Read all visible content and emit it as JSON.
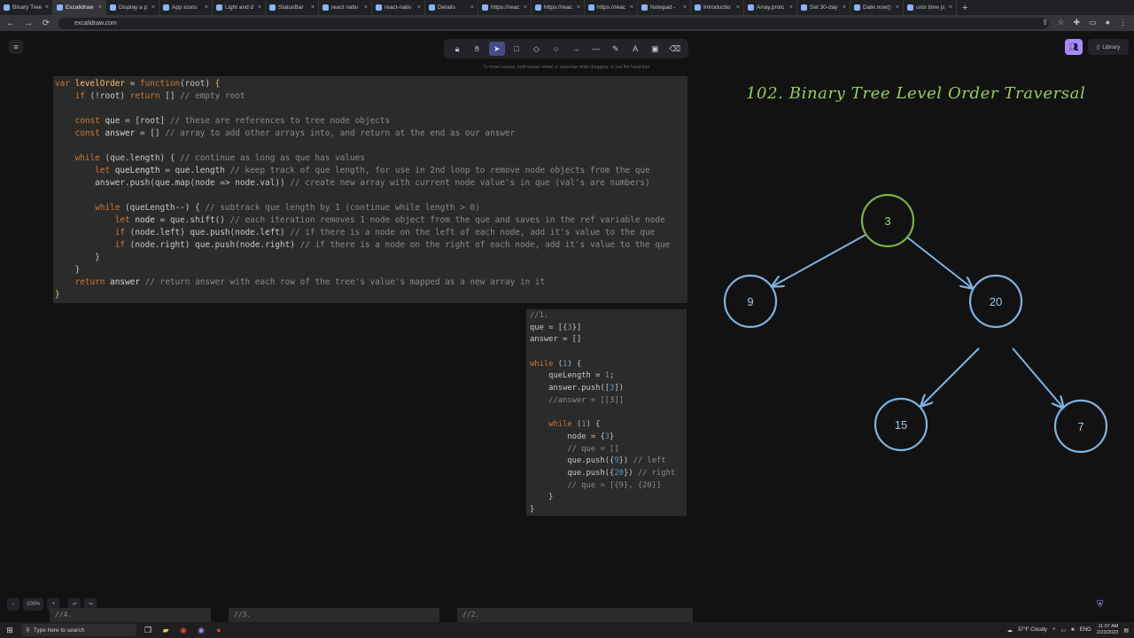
{
  "browser": {
    "tabs": [
      {
        "title": "Binary Tree",
        "active": false
      },
      {
        "title": "Excalidraw",
        "active": true
      },
      {
        "title": "Display a p",
        "active": false
      },
      {
        "title": "App icons",
        "active": false
      },
      {
        "title": "Light and d",
        "active": false
      },
      {
        "title": "StatusBar",
        "active": false
      },
      {
        "title": "react nativ",
        "active": false
      },
      {
        "title": "react-nativ",
        "active": false
      },
      {
        "title": "Details",
        "active": false
      },
      {
        "title": "https://reac",
        "active": false
      },
      {
        "title": "https://reac",
        "active": false
      },
      {
        "title": "https://reac",
        "active": false
      },
      {
        "title": "Notepad -",
        "active": false
      },
      {
        "title": "Introductio",
        "active": false
      },
      {
        "title": "Array.protc",
        "active": false
      },
      {
        "title": "Set 30-day",
        "active": false
      },
      {
        "title": "Date.now()",
        "active": false
      },
      {
        "title": "unix time js",
        "active": false
      }
    ],
    "new_tab": "+",
    "url": "excalidraw.com"
  },
  "canvas": {
    "hint": "To move canvas, hold mouse wheel or spacebar while dragging, or use the hand tool",
    "library_label": "Library",
    "zoom_level": "100%"
  },
  "code_main": [
    [
      [
        "kw",
        "var "
      ],
      [
        "fn",
        "levelOrder"
      ],
      [
        "plain",
        " = "
      ],
      [
        "kw",
        "function"
      ],
      [
        "plain",
        "(root) "
      ],
      [
        "brace",
        "{"
      ]
    ],
    [
      [
        "plain",
        "    "
      ],
      [
        "kw",
        "if"
      ],
      [
        "plain",
        " (!root) "
      ],
      [
        "kw",
        "return"
      ],
      [
        "plain",
        " [] "
      ],
      [
        "cmt",
        "// empty root"
      ]
    ],
    [
      [
        "plain",
        ""
      ]
    ],
    [
      [
        "plain",
        "    "
      ],
      [
        "kw",
        "const"
      ],
      [
        "var",
        " que"
      ],
      [
        "plain",
        " = [root] "
      ],
      [
        "cmt",
        "// these are references to tree node objects"
      ]
    ],
    [
      [
        "plain",
        "    "
      ],
      [
        "kw",
        "const"
      ],
      [
        "var",
        " answer"
      ],
      [
        "plain",
        " = [] "
      ],
      [
        "cmt",
        "// array to add other arrays into, and return at the end as our answer"
      ]
    ],
    [
      [
        "plain",
        ""
      ]
    ],
    [
      [
        "plain",
        "    "
      ],
      [
        "kw",
        "while"
      ],
      [
        "plain",
        " (que.length) { "
      ],
      [
        "cmt",
        "// continue as long as que has values"
      ]
    ],
    [
      [
        "plain",
        "        "
      ],
      [
        "kw",
        "let"
      ],
      [
        "var",
        " queLength"
      ],
      [
        "plain",
        " = que.length "
      ],
      [
        "cmt",
        "// keep track of que length, for use in 2nd loop to remove node objects from the que"
      ]
    ],
    [
      [
        "plain",
        "        answer.push(que.map(node => node.val)) "
      ],
      [
        "cmt",
        "// create new array with current node value's in que (val's are numbers)"
      ]
    ],
    [
      [
        "plain",
        ""
      ]
    ],
    [
      [
        "plain",
        "        "
      ],
      [
        "kw",
        "while"
      ],
      [
        "plain",
        " (queLength--) { "
      ],
      [
        "cmt",
        "// subtrack que length by 1 (continue while length > 0)"
      ]
    ],
    [
      [
        "plain",
        "            "
      ],
      [
        "kw",
        "let"
      ],
      [
        "var",
        " node"
      ],
      [
        "plain",
        " = que.shift() "
      ],
      [
        "cmt",
        "// each iteration removes 1 node object from the que and saves in the ref variable node"
      ]
    ],
    [
      [
        "plain",
        "            "
      ],
      [
        "kw",
        "if"
      ],
      [
        "plain",
        " (node.left) que.push(node.left) "
      ],
      [
        "cmt",
        "// if there is a node on the left of each node, add it's value to the que"
      ]
    ],
    [
      [
        "plain",
        "            "
      ],
      [
        "kw",
        "if"
      ],
      [
        "plain",
        " (node.right) que.push(node.right) "
      ],
      [
        "cmt",
        "// if there is a node on the right of each node, add it's value to the que"
      ]
    ],
    [
      [
        "plain",
        "        }"
      ]
    ],
    [
      [
        "plain",
        "    }"
      ]
    ],
    [
      [
        "plain",
        "    "
      ],
      [
        "kw",
        "return"
      ],
      [
        "var",
        " answer"
      ],
      [
        "plain",
        " "
      ],
      [
        "cmt",
        "// return answer with each row of the tree's value's mapped as a new array in it"
      ]
    ],
    [
      [
        "brace",
        "}"
      ]
    ]
  ],
  "code_trace": [
    [
      [
        "cmt",
        "//1."
      ]
    ],
    [
      [
        "plain",
        "que = [{"
      ],
      [
        "num",
        "3"
      ],
      [
        "plain",
        "}]"
      ]
    ],
    [
      [
        "plain",
        "answer = []"
      ]
    ],
    [
      [
        "plain",
        ""
      ]
    ],
    [
      [
        "kw",
        "while"
      ],
      [
        "plain",
        " ("
      ],
      [
        "num",
        "1"
      ],
      [
        "plain",
        ") {"
      ]
    ],
    [
      [
        "plain",
        "    queLength = "
      ],
      [
        "num",
        "1"
      ],
      [
        "plain",
        ";"
      ]
    ],
    [
      [
        "plain",
        "    answer.push(["
      ],
      [
        "num",
        "3"
      ],
      [
        "plain",
        "])"
      ]
    ],
    [
      [
        "cmt",
        "    //answer = [[3]]"
      ]
    ],
    [
      [
        "plain",
        ""
      ]
    ],
    [
      [
        "kw",
        "    while"
      ],
      [
        "plain",
        " ("
      ],
      [
        "num",
        "1"
      ],
      [
        "plain",
        ") {"
      ]
    ],
    [
      [
        "plain",
        "        node = {"
      ],
      [
        "num",
        "3"
      ],
      [
        "plain",
        "}"
      ]
    ],
    [
      [
        "cmt",
        "        // que = []"
      ]
    ],
    [
      [
        "plain",
        "        que.push({"
      ],
      [
        "num",
        "9"
      ],
      [
        "plain",
        "}) "
      ],
      [
        "cmt",
        "// left"
      ]
    ],
    [
      [
        "plain",
        "        que.push({"
      ],
      [
        "num",
        "20"
      ],
      [
        "plain",
        "}) "
      ],
      [
        "cmt",
        "// right"
      ]
    ],
    [
      [
        "cmt",
        "        // que = [{9}, {20}]"
      ]
    ],
    [
      [
        "plain",
        "    }"
      ]
    ],
    [
      [
        "plain",
        "}"
      ]
    ]
  ],
  "diagram": {
    "title": "102. Binary Tree Level Order Traversal",
    "nodes": [
      {
        "id": "n3",
        "label": "3",
        "color": "#7cb342"
      },
      {
        "id": "n9",
        "label": "9",
        "color": "#7fb3e0"
      },
      {
        "id": "n20",
        "label": "20",
        "color": "#7fb3e0"
      },
      {
        "id": "n15",
        "label": "15",
        "color": "#7fb3e0"
      },
      {
        "id": "n7",
        "label": "7",
        "color": "#7fb3e0"
      }
    ]
  },
  "frames": [
    {
      "label": "//4."
    },
    {
      "label": "//3."
    },
    {
      "label": "//2."
    }
  ],
  "taskbar": {
    "search_placeholder": "Type here to search",
    "weather": "37°F  Cloudy",
    "lang": "ENG",
    "time": "11:07 AM",
    "date": "2/23/2023"
  }
}
